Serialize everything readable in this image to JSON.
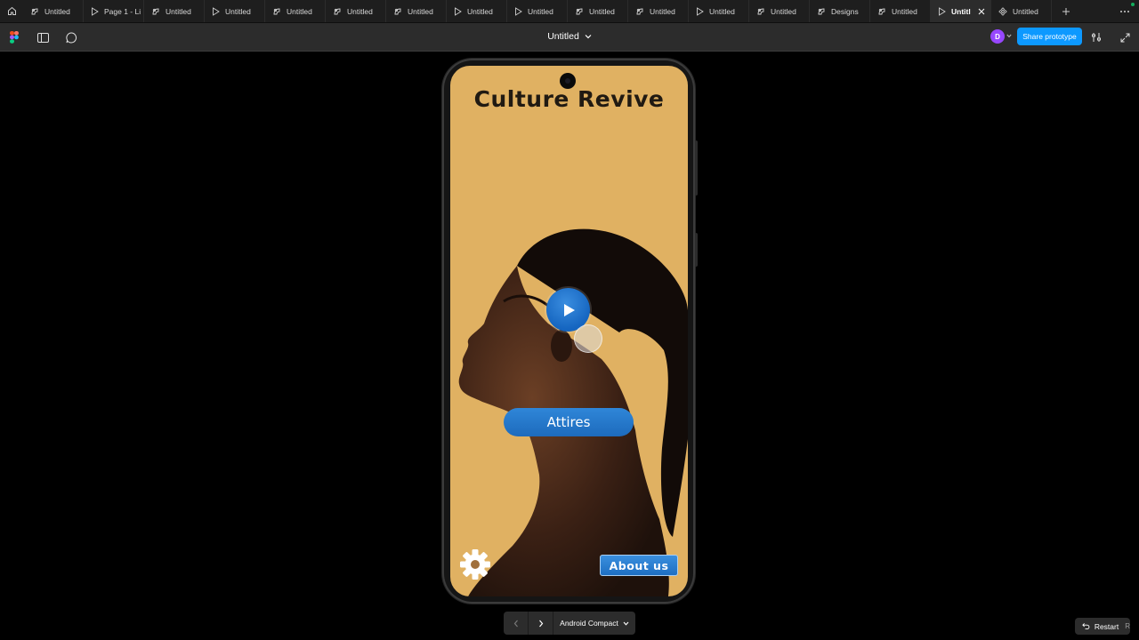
{
  "tabs": [
    {
      "label": "Untitled",
      "icon": "figjam-icon"
    },
    {
      "label": "Page 1 - Li",
      "icon": "play-icon"
    },
    {
      "label": "Untitled",
      "icon": "figjam-icon"
    },
    {
      "label": "Untitled",
      "icon": "play-icon"
    },
    {
      "label": "Untitled",
      "icon": "figjam-icon"
    },
    {
      "label": "Untitled",
      "icon": "figjam-icon"
    },
    {
      "label": "Untitled",
      "icon": "figjam-icon"
    },
    {
      "label": "Untitled",
      "icon": "play-icon"
    },
    {
      "label": "Untitled",
      "icon": "play-icon"
    },
    {
      "label": "Untitled",
      "icon": "figjam-icon"
    },
    {
      "label": "Untitled",
      "icon": "figjam-icon"
    },
    {
      "label": "Untitled",
      "icon": "play-icon"
    },
    {
      "label": "Untitled",
      "icon": "figjam-icon"
    },
    {
      "label": "Designs",
      "icon": "figjam-icon"
    },
    {
      "label": "Untitled",
      "icon": "figjam-icon"
    },
    {
      "label": "Untitl",
      "icon": "play-icon",
      "active": true
    },
    {
      "label": "Untitled",
      "icon": "component-icon"
    }
  ],
  "toolbar": {
    "file_title": "Untitled",
    "avatar_initial": "D",
    "share_label": "Share prototype"
  },
  "app": {
    "title": "Culture Revive",
    "attires_label": "Attires",
    "about_label": "About us"
  },
  "bottom": {
    "device_label": "Android Compact",
    "restart_label": "Restart",
    "restart_key": "R"
  },
  "colors": {
    "accent": "#0d99ff",
    "screen_bg": "#e0b162",
    "button_blue": "#1e6fc3",
    "avatar": "#9747ff"
  }
}
